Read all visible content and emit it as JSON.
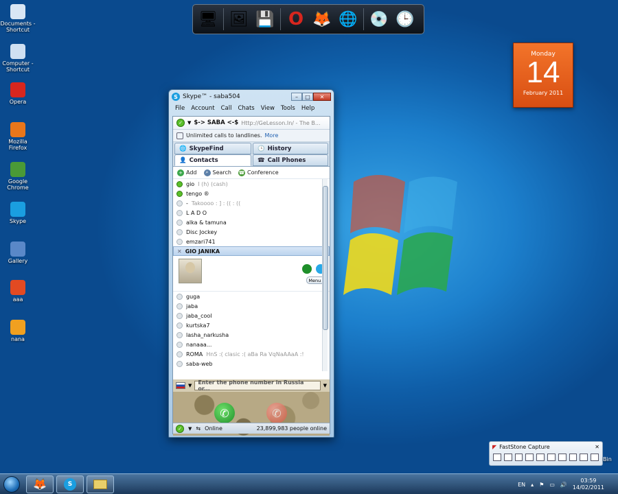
{
  "desktop": {
    "icons": [
      {
        "label": "Documents - Shortcut",
        "icon": "documents-icon",
        "color": "#d9e6f4"
      },
      {
        "label": "Computer - Shortcut",
        "icon": "computer-icon",
        "color": "#cfe0f2"
      },
      {
        "label": "Opera",
        "icon": "opera-icon",
        "color": "#d7261e"
      },
      {
        "label": "Mozilla Firefox",
        "icon": "firefox-icon",
        "color": "#e8761a"
      },
      {
        "label": "Google Chrome",
        "icon": "chrome-icon",
        "color": "#4a9a37"
      },
      {
        "label": "Skype",
        "icon": "skype-icon",
        "color": "#1a9ee0"
      },
      {
        "label": "Gallery",
        "icon": "gallery-icon",
        "color": "#5a88c8"
      },
      {
        "label": "ааа",
        "icon": "checkmark-icon",
        "color": "#e24a22"
      },
      {
        "label": "nana",
        "icon": "app-icon",
        "color": "#f0a020"
      }
    ]
  },
  "calendar": {
    "weekday": "Monday",
    "day": "14",
    "month_year": "February 2011"
  },
  "skype": {
    "title": "Skype™ - saba504",
    "menu": [
      "File",
      "Account",
      "Call",
      "Chats",
      "View",
      "Tools",
      "Help"
    ],
    "mood_name": "$-> SABA <-$",
    "mood_text": "Http://GeLesson.In/ - The B...",
    "promo_text": "Unlimited calls to landlines.",
    "promo_link": "More",
    "tabs": {
      "skypefind": "SkypeFind",
      "history": "History",
      "contacts": "Contacts",
      "call_phones": "Call Phones"
    },
    "toolbar": {
      "add": "Add",
      "search": "Search",
      "conference": "Conference"
    },
    "contacts_before": [
      {
        "name": "gio",
        "mood": "I (h) (cash)",
        "online": true
      },
      {
        "name": "tengo ®",
        "mood": "",
        "online": true
      },
      {
        "name": "-",
        "mood": "Takoooo : ] : (( : ((",
        "online": false
      },
      {
        "name": "L A D O",
        "mood": "",
        "online": false
      },
      {
        "name": "alka & tamuna",
        "mood": "",
        "online": false
      },
      {
        "name": "Disc Jockey",
        "mood": "",
        "online": false
      },
      {
        "name": "emzari741",
        "mood": "",
        "online": false
      }
    ],
    "selected_contact": "GIO JANIKA",
    "menu_button": "Menu",
    "contacts_after": [
      {
        "name": "guga",
        "mood": "",
        "online": false
      },
      {
        "name": "jaba",
        "mood": "",
        "online": false
      },
      {
        "name": "jaba_cool",
        "mood": "",
        "online": false
      },
      {
        "name": "kurtska7",
        "mood": "",
        "online": false
      },
      {
        "name": "lasha_narkusha",
        "mood": "",
        "online": false
      },
      {
        "name": "nanaaa...",
        "mood": "",
        "online": false
      },
      {
        "name": "ROMA",
        "mood": "HnS :( clasic :( aBa Ra VqNaAAaA :!",
        "online": false
      },
      {
        "name": "saba-web",
        "mood": "",
        "online": false
      }
    ],
    "dial_placeholder": "Enter the phone number in Russia or...",
    "status": "Online",
    "people_online": "23,899,983 people online"
  },
  "faststone": {
    "title": "FastStone Capture"
  },
  "taskbar": {
    "lang": "EN",
    "time": "03:59",
    "date": "14/02/2011",
    "recycle": "Bin"
  },
  "colors": {
    "accent": "#1a9ee0",
    "online": "#5bbf2a",
    "call_green": "#1f8f2a",
    "calendar": "#e8601c"
  }
}
